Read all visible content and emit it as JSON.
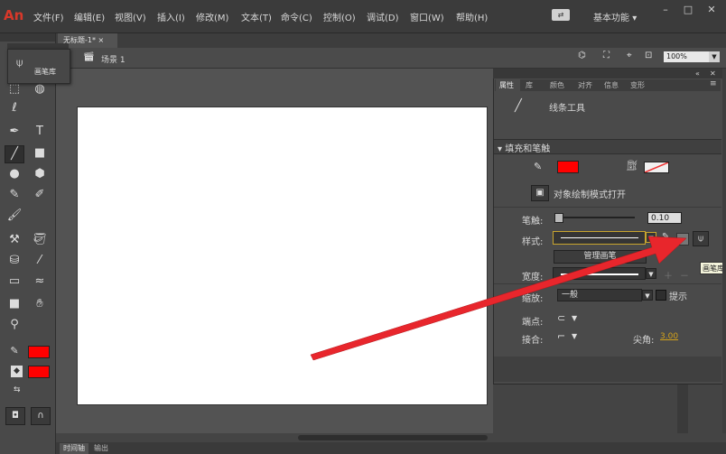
{
  "app": {
    "logo": "An"
  },
  "menu": [
    "文件(F)",
    "编辑(E)",
    "视图(V)",
    "插入(I)",
    "修改(M)",
    "文本(T)",
    "命令(C)",
    "控制(O)",
    "调试(D)",
    "窗口(W)",
    "帮助(H)"
  ],
  "titlebar": {
    "workspace": "基本功能",
    "sync_icon": "sync-icon"
  },
  "document": {
    "tab_title": "无标题-1*",
    "close": "×"
  },
  "scene": {
    "label": "场景 1",
    "zoom": "100%"
  },
  "brush_popup": {
    "label": "画笔库"
  },
  "properties": {
    "tabs": [
      "属性",
      "库",
      "颜色",
      "对齐",
      "信息",
      "变形"
    ],
    "tool_name": "线条工具",
    "fill_stroke_section": "填充和笔触",
    "stroke_color": "#ff0000",
    "object_draw_mode": "对象绘制模式打开",
    "stroke_label": "笔触:",
    "stroke_value": "0.10",
    "style_label": "样式:",
    "manage_brushes": "管理画笔",
    "width_label": "宽度:",
    "scale_label": "缩放:",
    "scale_value": "一般",
    "hint_label": "提示",
    "cap_label": "端点:",
    "join_label": "接合:",
    "miter_label": "尖角:",
    "miter_value": "3.00",
    "tooltip": "画笔库"
  },
  "toolbar": {
    "fill_color": "#ff0000",
    "stroke_color": "#ff0000"
  },
  "bottom_tabs": [
    "时间轴",
    "输出"
  ],
  "annotation": {
    "arrow_color": "#e8262c"
  }
}
